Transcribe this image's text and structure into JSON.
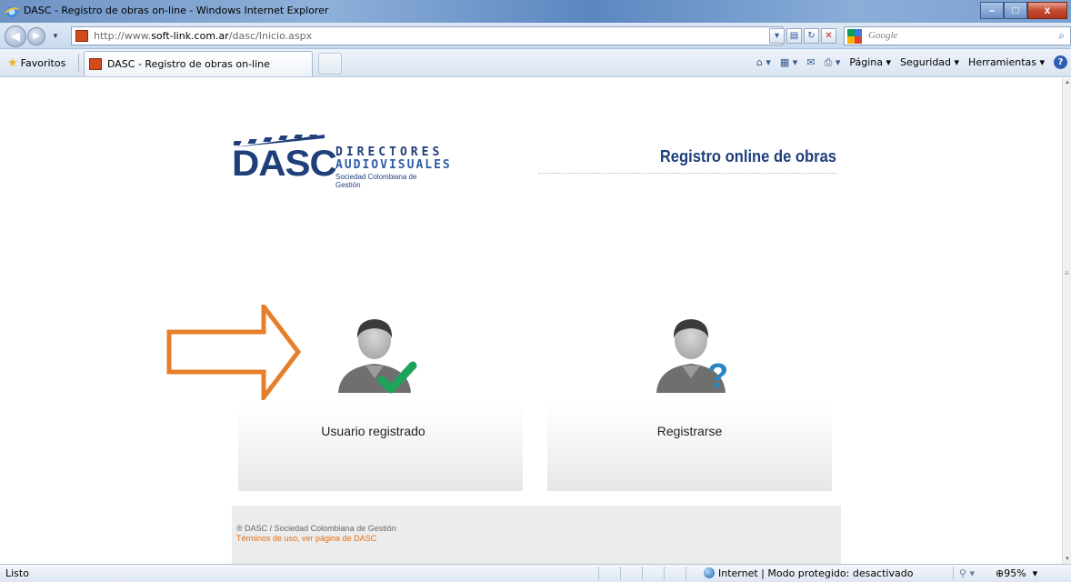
{
  "window": {
    "title": "DASC - Registro de obras on-line - Windows Internet Explorer",
    "min": "–",
    "max": "□",
    "close": "x"
  },
  "address": {
    "url_prefix": "http://www.",
    "url_domain": "soft-link.com.ar",
    "url_path": "/dasc/Inicio.aspx",
    "search_placeholder": "Google"
  },
  "favbar": {
    "favorites_label": "Favoritos",
    "tab_label": "DASC - Registro de obras on-line",
    "cmd_page": "Página ▾",
    "cmd_security": "Seguridad ▾",
    "cmd_tools": "Herramientas ▾"
  },
  "page": {
    "logo": {
      "brand": "DASC",
      "line1": "DIRECTORES",
      "line2": "AUDIOVISUALES",
      "line3": "Sociedad Colombiana de Gestión"
    },
    "header_title": "Registro online de obras",
    "cards": {
      "registered_label": "Usuario registrado",
      "register_label": "Registrarse"
    },
    "footer": {
      "copyright": "® DASC / Sociedad Colombiana de Gestión",
      "terms": "Términos de uso, ver página de DASC"
    },
    "colors": {
      "brand_blue": "#1f3f7a",
      "arrow_orange": "#e77f2a",
      "check_green": "#1fa35b",
      "question_blue": "#2b86c5"
    }
  },
  "status": {
    "ready": "Listo",
    "zone": "Internet | Modo protegido: desactivado",
    "zoom": "95%"
  }
}
